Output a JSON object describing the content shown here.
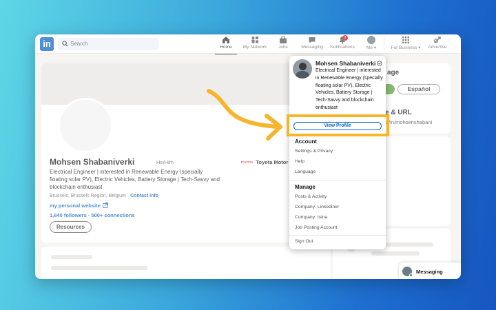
{
  "nav": {
    "search_placeholder": "Search",
    "items": [
      {
        "label": "Home",
        "icon": "home-icon"
      },
      {
        "label": "My Network",
        "icon": "network-icon"
      },
      {
        "label": "Jobs",
        "icon": "briefcase-icon"
      },
      {
        "label": "Messaging",
        "icon": "chat-icon"
      },
      {
        "label": "Notifications",
        "icon": "bell-icon",
        "badge": "2"
      },
      {
        "label": "Me",
        "icon": "avatar"
      },
      {
        "label": "For Business",
        "icon": "grid-icon"
      },
      {
        "label": "Advertise",
        "icon": "advertise-icon"
      }
    ]
  },
  "profile": {
    "name": "Mohsen Shabaniverki",
    "pronouns": "He/Him",
    "headline": "Electrical Engineer | interested in Renewable Energy (specially floating solar PV), Electric Vehicles, Battery Storage | Tech-Savvy and blockchain enthusiast",
    "location": "Brussels, Brussels Region, Belgium",
    "contact_info": "Contact info",
    "website": "my personal website",
    "connections": "1,640 followers · 500+ connections",
    "resources_button": "Resources",
    "company": "Toyota Motor I",
    "company_logo_text": "TOYOTA"
  },
  "right": {
    "language_title": "age",
    "language_button": "Español",
    "url_title": "e & URL",
    "url_value": "n/in/mohsenshabani"
  },
  "messaging_label": "Messaging",
  "dropdown": {
    "name": "Mohsen Shabaniverki",
    "headline": "Electrical Engineer | interested in Renewable Energy (specially floating solar PV), Electric Vehicles, Battery Storage | Tech-Savvy and blockchain enthusiast",
    "view_profile": "View Profile",
    "account_title": "Account",
    "account_items": [
      "Settings & Privacy",
      "Help",
      "Language"
    ],
    "manage_title": "Manage",
    "manage_items": [
      "Posts & Activity",
      "Company: Linkediner",
      "Company: Isina",
      "Job Posting Account"
    ],
    "sign_out": "Sign Out"
  },
  "colors": {
    "brand": "#0a66c2",
    "highlight": "#f7b52c",
    "arrow": "#f7b52c"
  }
}
